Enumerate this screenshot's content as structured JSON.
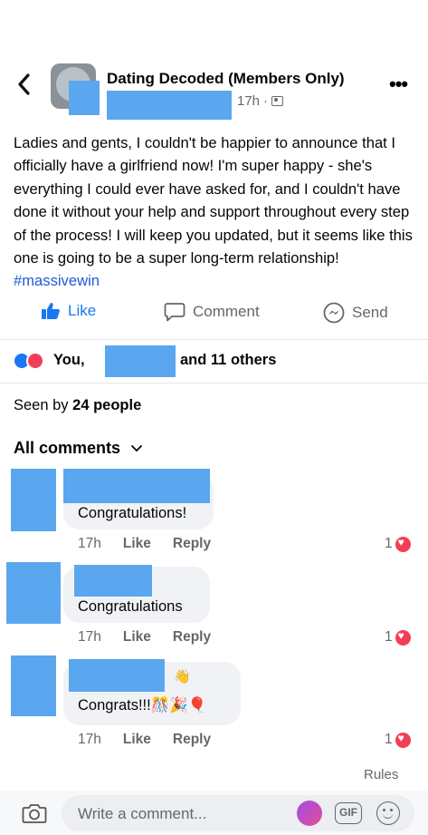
{
  "header": {
    "group_name": "Dating Decoded (Members Only)",
    "time": "17h",
    "separator": "·",
    "more": "•••"
  },
  "post": {
    "text": "Ladies and gents, I couldn't be happier to announce that I officially have a girlfriend now! I'm super happy - she's everything I could ever have asked for, and I couldn't have done it without your help and support throughout every step of the process! I will keep you updated, but it seems like this one is going to be a super long-term relationship!",
    "hashtag": "#massivewin"
  },
  "actions": {
    "like": "Like",
    "comment": "Comment",
    "send": "Send"
  },
  "reactions": {
    "you": "You,",
    "others": "and 11 others"
  },
  "seen": {
    "prefix": "Seen by",
    "count": "24 people"
  },
  "comments_header": {
    "label": "All comments"
  },
  "comments": [
    {
      "text": "Congratulations!",
      "time": "17h",
      "like": "Like",
      "reply": "Reply",
      "likes": "1"
    },
    {
      "text": "Congratulations",
      "time": "17h",
      "like": "Like",
      "reply": "Reply",
      "likes": "1"
    },
    {
      "text": "Congrats!!!",
      "emoji": "🎊🎉🎈",
      "badge_emoji": "👋",
      "time": "17h",
      "like": "Like",
      "reply": "Reply",
      "likes": "1"
    }
  ],
  "footer": {
    "rules": "Rules",
    "placeholder": "Write a comment...",
    "gif": "GIF"
  },
  "colors": {
    "accent": "#1877f2",
    "hashtag": "#1e5bd6",
    "redaction": "#5aa7ef",
    "love": "#f33e58"
  }
}
